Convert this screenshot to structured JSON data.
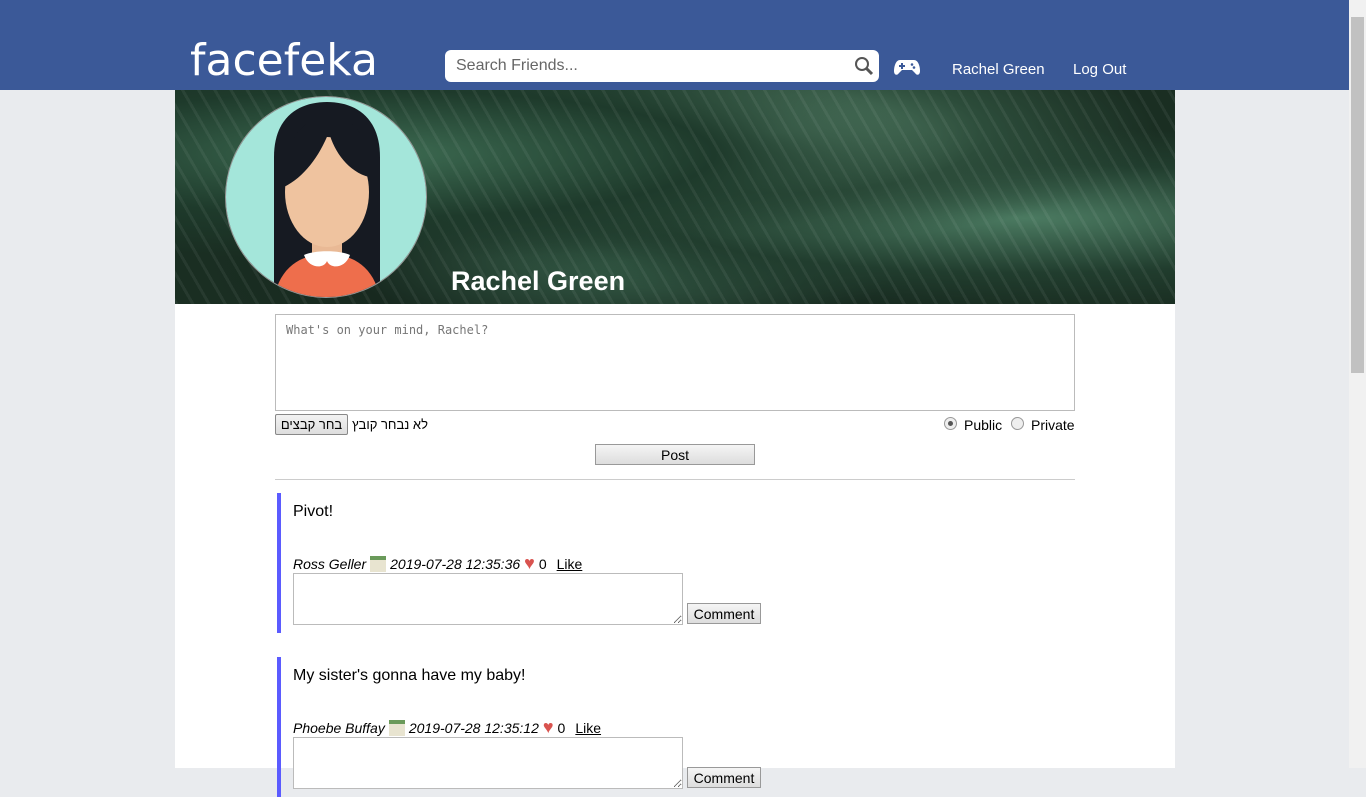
{
  "header": {
    "logo": "facefeka",
    "search_placeholder": "Search Friends...",
    "user_link": "Rachel Green",
    "logout": "Log Out"
  },
  "profile": {
    "name": "Rachel Green"
  },
  "composer": {
    "placeholder": "What's on your mind, Rachel?",
    "file_button": "בחר קבצים",
    "no_file": "לא נבחר קובץ",
    "public": "Public",
    "private": "Private",
    "post": "Post"
  },
  "posts": [
    {
      "text": "Pivot!",
      "author": "Ross Geller",
      "date": "2019-07-28 12:35:36",
      "likes": "0",
      "like": "Like",
      "comment": "Comment"
    },
    {
      "text": "My sister's gonna have my baby!",
      "author": "Phoebe Buffay",
      "date": "2019-07-28 12:35:12",
      "likes": "0",
      "like": "Like",
      "comment": "Comment"
    }
  ]
}
